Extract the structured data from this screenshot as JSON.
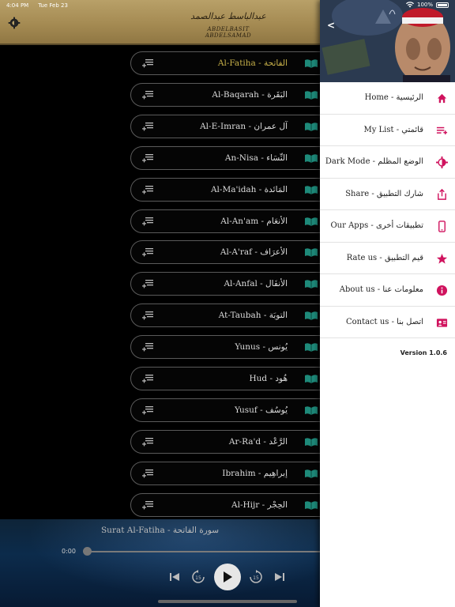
{
  "status": {
    "time": "4:04 PM",
    "date": "Tue Feb 23",
    "battery": "100%"
  },
  "header": {
    "logo_ar": "عبدالباسط عبدالصمد",
    "logo_en": "ABDELBASIT ABDELSAMAD",
    "settings_icon": "gear-icon"
  },
  "surahs": [
    {
      "label": "Al-Fatiha - الفاتحة",
      "active": true
    },
    {
      "label": "Al-Baqarah - البَقَرة",
      "active": false
    },
    {
      "label": "Al-E-Imran - آل عمران",
      "active": false
    },
    {
      "label": "An-Nisa - النِّسَاء",
      "active": false
    },
    {
      "label": "Al-Ma'idah - المَائدة",
      "active": false
    },
    {
      "label": "Al-An'am - الأنعَام",
      "active": false
    },
    {
      "label": "Al-A'raf - الأعرَاف",
      "active": false
    },
    {
      "label": "Al-Anfal - الأنفَال",
      "active": false
    },
    {
      "label": "At-Taubah - التوبَة",
      "active": false
    },
    {
      "label": "Yunus - يُونس",
      "active": false
    },
    {
      "label": "Hud - هُود",
      "active": false
    },
    {
      "label": "Yusuf - يُوسُف",
      "active": false
    },
    {
      "label": "Ar-Ra'd - الرَّعْد",
      "active": false
    },
    {
      "label": "Ibrahim - إبراهِيم",
      "active": false
    },
    {
      "label": "Al-Hijr - الحِجْر",
      "active": false
    }
  ],
  "player": {
    "title": "Surat Al-Fatiha - سورة الفاتحة",
    "time": "0:00",
    "progress": 0,
    "skip_back": "15",
    "skip_fwd": "15"
  },
  "drawer": {
    "back": "<",
    "menu": [
      {
        "label": "Home - الرئيسية",
        "icon": "home-icon"
      },
      {
        "label": "My List - قائمتي",
        "icon": "playlist-icon"
      },
      {
        "label": "Dark Mode - الوضع المظلم",
        "icon": "dark-mode-icon"
      },
      {
        "label": "Share - شارك التطبيق",
        "icon": "share-icon"
      },
      {
        "label": "Our Apps - تطبيقات أخرى",
        "icon": "phone-icon"
      },
      {
        "label": "Rate us - قيم التطبيق",
        "icon": "star-icon"
      },
      {
        "label": "About us - معلومات عنا",
        "icon": "info-icon"
      },
      {
        "label": "Contact us - اتصل بنا",
        "icon": "contact-card-icon"
      }
    ],
    "version": "Version 1.0.6"
  },
  "colors": {
    "accent": "#d0135e",
    "gold": "#c9b24a",
    "book": "#1e8a7a"
  }
}
